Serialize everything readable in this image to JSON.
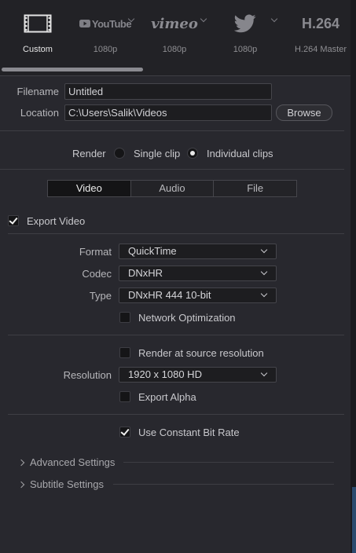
{
  "presets": [
    {
      "label": "Custom",
      "icon": "film-icon",
      "active": true
    },
    {
      "label": "1080p",
      "brand": "YouTube",
      "icon": "youtube-icon"
    },
    {
      "label": "1080p",
      "brand": "vimeo",
      "icon": "vimeo-icon"
    },
    {
      "label": "1080p",
      "icon": "twitter-icon"
    },
    {
      "label": "H.264 Master",
      "brand": "H.264"
    }
  ],
  "file": {
    "filename_label": "Filename",
    "filename_value": "Untitled",
    "location_label": "Location",
    "location_value": "C:\\Users\\Salik\\Videos",
    "browse_label": "Browse"
  },
  "render": {
    "label": "Render",
    "options": [
      "Single clip",
      "Individual clips"
    ],
    "selected": "Individual clips"
  },
  "tabs": [
    "Video",
    "Audio",
    "File"
  ],
  "active_tab": "Video",
  "export_video": {
    "label": "Export Video",
    "checked": true
  },
  "format": {
    "label": "Format",
    "value": "QuickTime"
  },
  "codec": {
    "label": "Codec",
    "value": "DNxHR"
  },
  "type": {
    "label": "Type",
    "value": "DNxHR 444 10-bit"
  },
  "network_opt": {
    "label": "Network Optimization",
    "checked": false
  },
  "render_source": {
    "label": "Render at source resolution",
    "checked": false
  },
  "resolution": {
    "label": "Resolution",
    "value": "1920 x 1080 HD"
  },
  "export_alpha": {
    "label": "Export Alpha",
    "checked": false
  },
  "constant_bitrate": {
    "label": "Use Constant Bit Rate",
    "checked": true
  },
  "sections": [
    "Advanced Settings",
    "Subtitle Settings"
  ],
  "colors": {
    "background": "#28282e",
    "header": "#222226",
    "accent_blue": "#2a4a6e"
  }
}
